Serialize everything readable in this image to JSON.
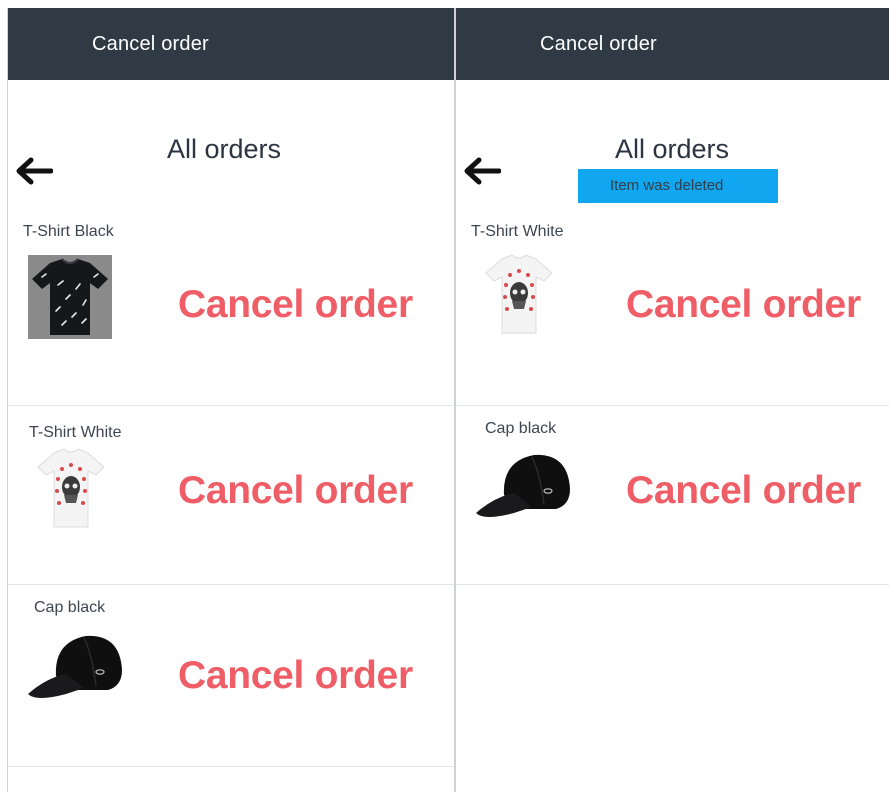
{
  "screens": {
    "left": {
      "header_title": "Cancel order",
      "page_title": "All orders",
      "orders": [
        {
          "name": "T-Shirt Black",
          "action": "Cancel order"
        },
        {
          "name": "T-Shirt White",
          "action": "Cancel order"
        },
        {
          "name": "Cap black",
          "action": "Cancel order"
        }
      ]
    },
    "right": {
      "header_title": "Cancel order",
      "page_title": "All orders",
      "toast": "Item was deleted",
      "orders": [
        {
          "name": "T-Shirt White",
          "action": "Cancel order"
        },
        {
          "name": "Cap black",
          "action": "Cancel order"
        }
      ]
    }
  },
  "colors": {
    "header_bg": "#2f3a45",
    "cancel_red": "#ef5e66",
    "toast_blue": "#10a6f0"
  },
  "icons": {
    "back": "arrow-left-icon"
  }
}
